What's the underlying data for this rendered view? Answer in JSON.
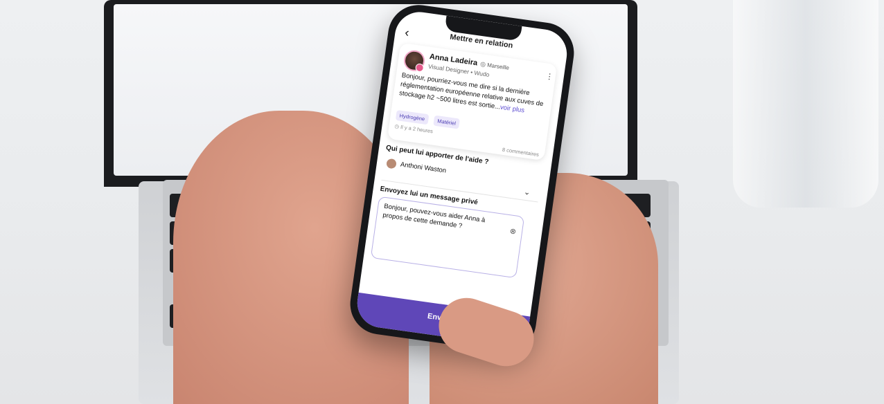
{
  "header": {
    "title": "Mettre en relation"
  },
  "post": {
    "author": "Anna Ladeira",
    "location": "Marseille",
    "role": "Visual Designer • Wudo",
    "question": "Bonjour, pourriez-vous me dire si la dernière réglementation européenne relative aux cuves de stockage h2 ~500 litres est sortie...",
    "more_link": "voir plus",
    "tags": [
      "Hydrogène",
      "Matériel"
    ],
    "time": "Il y a 2 heures",
    "comments": "8 commentaires"
  },
  "helper": {
    "label": "Qui peut lui apporter de l'aide ?",
    "selected": "Anthoni Waston"
  },
  "message": {
    "label": "Envoyez lui un message privé",
    "value": "Bonjour, pouvez-vous aider Anna à propos de cette demande ?"
  },
  "send": {
    "label": "Envoyer"
  },
  "icons": {
    "back": "back-arrow-icon",
    "more": "more-vertical-icon",
    "location": "location-pin-icon",
    "chevron": "chevron-down-icon",
    "clear": "clear-circle-icon"
  }
}
